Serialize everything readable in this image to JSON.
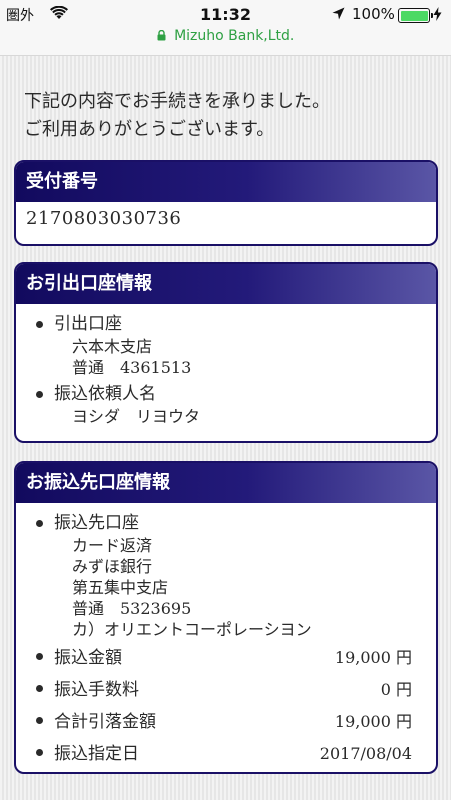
{
  "status_bar": {
    "carrier": "圏外",
    "time": "11:32",
    "battery": "100%",
    "battery_level": 1.0,
    "url": "Mizuho Bank,Ltd."
  },
  "intro": {
    "line1": "下記の内容でお手続きを承りました。",
    "line2": "ご利用ありがとうございます。"
  },
  "receipt": {
    "title": "受付番号",
    "number": "2170803030736"
  },
  "debit_account": {
    "title": "お引出口座情報",
    "account_label": "引出口座",
    "branch": "六本木支店",
    "account": "普通　4361513",
    "requester_label": "振込依頼人名",
    "requester": "ヨシダ　リヨウタ"
  },
  "transfer": {
    "title": "お振込先口座情報",
    "dest_label": "振込先口座",
    "dest_lines": [
      "カード返済",
      "みずほ銀行",
      "第五集中支店",
      "普通　5323695",
      "カ）オリエントコーポレーシヨン"
    ],
    "amount_label": "振込金額",
    "amount": "19,000 円",
    "fee_label": "振込手数料",
    "fee": "0 円",
    "total_label": "合計引落金額",
    "total": "19,000 円",
    "date_label": "振込指定日",
    "date": "2017/08/04"
  },
  "colors": {
    "header_dark": "#120a5e",
    "header_light": "#5a56a6",
    "url_green": "#2ea043",
    "battery_green": "#4cd964"
  }
}
